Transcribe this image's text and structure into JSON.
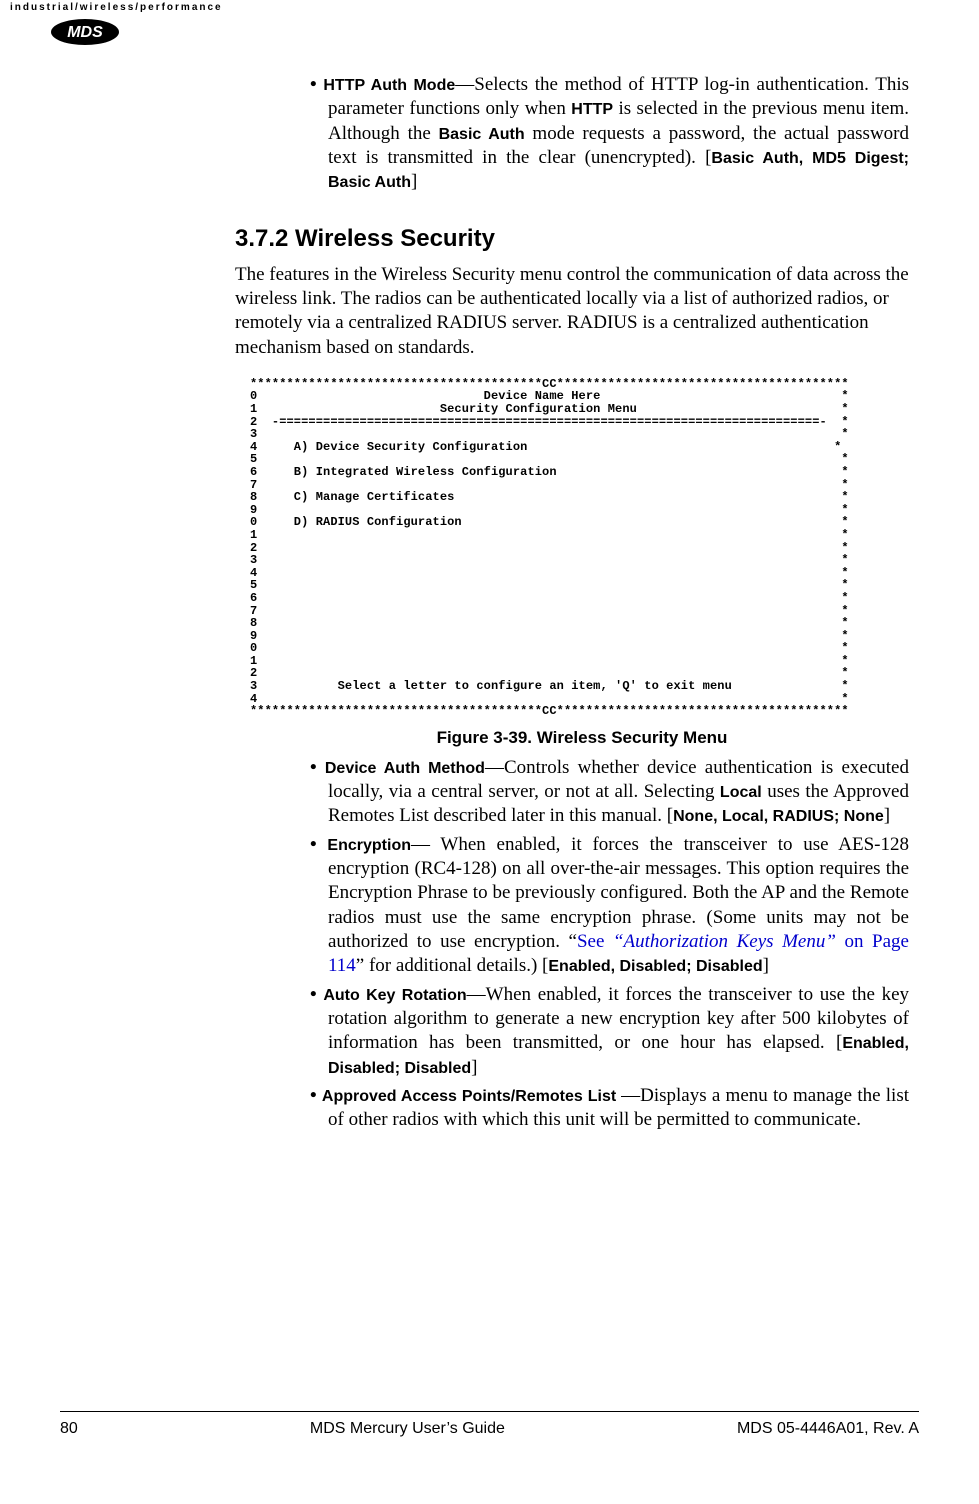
{
  "header": {
    "top_tag": "industrial/wireless/performance",
    "logo_text": "MDS"
  },
  "blocks": {
    "http_auth": {
      "term": "HTTP Auth Mode",
      "text_pre": "—Selects the method of HTTP log-in authentication. This parameter functions only when ",
      "sans1": "HTTP",
      "text_mid": " is selected in the previous menu item. Although the ",
      "sans2": "Basic Auth",
      "text_post": " mode requests a password, the actual password text is transmitted in the clear (unencrypted). [",
      "options": "Basic Auth, MD5 Digest; Basic Auth",
      "close": "]"
    },
    "section_heading": "3.7.2 Wireless Security",
    "section_body": "The features in the Wireless Security menu control the communication of data across the wireless link. The radios can be authenticated locally via a list of authorized radios, or remotely via a centralized RADIUS server. RADIUS is a centralized authentication mechanism based on standards.",
    "figure_caption": "Figure 3-39. Wireless Security Menu",
    "device_auth": {
      "term": "Device Auth Method",
      "text_pre": "—Controls whether device authentication is executed locally, via a central server, or not at all. Selecting ",
      "sans1": "Local",
      "text_post": " uses the Approved Remotes List described later in this manual. [",
      "options": "None, Local, RADIUS; None",
      "close": "]"
    },
    "encryption": {
      "term": "Encryption",
      "text_pre": "— When enabled, it forces the transceiver to use AES-128 encryption (RC4-128) on all over-the-air messages. This option requires the Encryption Phrase to be previously configured. Both the AP and the Remote radios must use the same encryption phrase. (Some units may not be authorized to use encryption. “",
      "xref_see": "See ",
      "xref_title": "“Authorization Keys Menu”",
      "xref_page": " on Page 114",
      "text_post": "” for additional details.) [",
      "options": "Enabled, Disabled; Disabled",
      "close": "]"
    },
    "auto_key": {
      "term": "Auto Key Rotation",
      "text": "—When enabled, it forces the transceiver to use the key rotation algorithm to generate a new encryption key after 500 kilobytes of information has been transmitted, or one hour has elapsed. [",
      "options": "Enabled, Disabled; Disabled",
      "close": "]"
    },
    "approved": {
      "term": "Approved Access Points/Remotes List ",
      "text": "—Displays a menu to manage the list of other radios with which this unit will be permitted to communicate."
    }
  },
  "terminal": "****************************************CC****************************************\n0                               Device Name Here                                 *\n1                         Security Configuration Menu                            *\n2  -==========================================================================-  *\n3                                                                                *\n4     A) Device Security Configuration                                          *\n5                                                                                *\n6     B) Integrated Wireless Configuration                                       *\n7                                                                                *\n8     C) Manage Certificates                                                     *\n9                                                                                *\n0     D) RADIUS Configuration                                                    *\n1                                                                                *\n2                                                                                *\n3                                                                                *\n4                                                                                *\n5                                                                                *\n6                                                                                *\n7                                                                                *\n8                                                                                *\n9                                                                                *\n0                                                                                *\n1                                                                                *\n2                                                                                *\n3           Select a letter to configure an item, 'Q' to exit menu               *\n4                                                                                *\n****************************************CC****************************************",
  "footer": {
    "page": "80",
    "title": "MDS Mercury User’s Guide",
    "docnum": "MDS 05-4446A01, Rev. A"
  }
}
